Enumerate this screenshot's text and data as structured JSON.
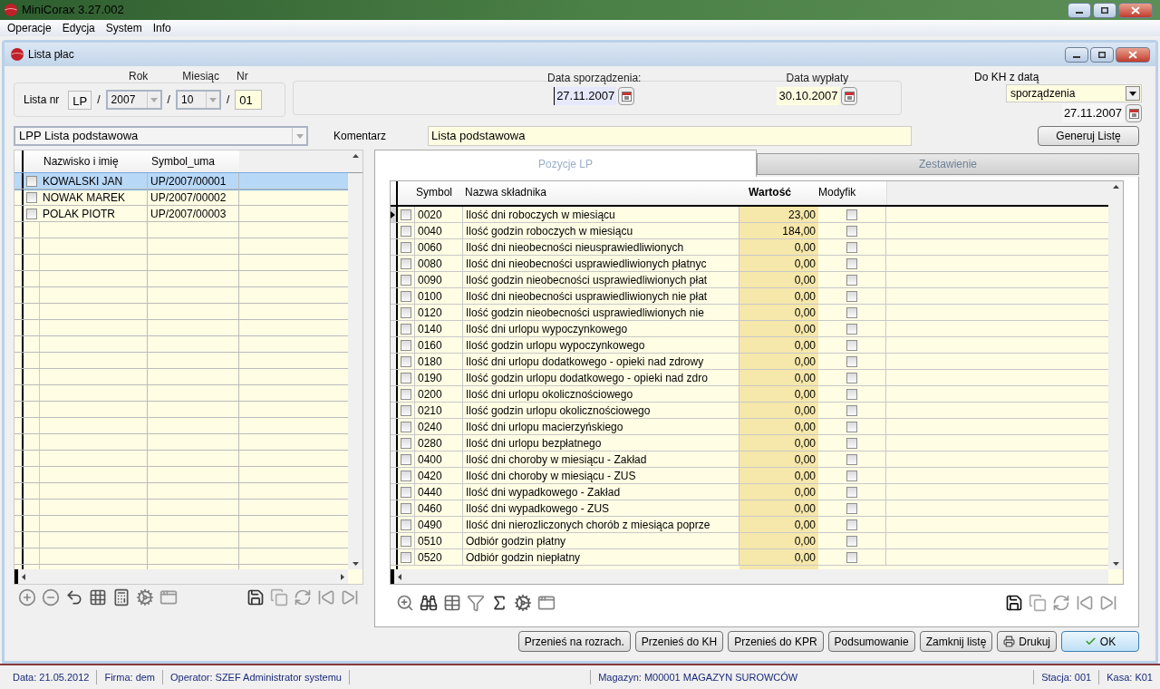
{
  "app_title": "MiniCorax 3.27.002",
  "menu": [
    "Operacje",
    "Edycja",
    "System",
    "Info"
  ],
  "window": {
    "title": "Lista płac"
  },
  "list_number": {
    "label": "Lista nr",
    "prefix": "LP",
    "year_label": "Rok",
    "year": "2007",
    "month_label": "Miesiąc",
    "month": "10",
    "nr_label": "Nr",
    "nr": "01",
    "separator": "/"
  },
  "dates": [
    {
      "label": "Data sporządzenia:",
      "value": "27.11.2007",
      "focused": true
    },
    {
      "label": "Data wypłaty",
      "value": "30.10.2007",
      "focused": false
    }
  ],
  "do_kh": {
    "label": "Do KH z datą",
    "mode": "sporządzenia",
    "date": "27.11.2007"
  },
  "list_type": "LPP Lista podstawowa",
  "comment": {
    "label": "Komentarz",
    "value": "Lista podstawowa"
  },
  "generate_button": "Generuj Listę",
  "employees": {
    "columns": [
      "Nazwisko i imię",
      "Symbol_uma"
    ],
    "rows": [
      {
        "name": "KOWALSKI JAN",
        "symbol": "UP/2007/00001",
        "checked": false,
        "selected": true
      },
      {
        "name": "NOWAK MAREK",
        "symbol": "UP/2007/00002",
        "checked": false,
        "selected": false
      },
      {
        "name": "POLAK PIOTR",
        "symbol": "UP/2007/00003",
        "checked": false,
        "selected": false
      }
    ]
  },
  "tabs": [
    {
      "label": "Pozycje LP",
      "selected": true
    },
    {
      "label": "Zestawienie",
      "selected": false
    }
  ],
  "components": {
    "columns": [
      "Symbol",
      "Nazwa składnika",
      "Wartość",
      "Modyfik"
    ],
    "rows": [
      {
        "symbol": "0020",
        "name": "Ilość dni roboczych w miesiącu",
        "value": "23,00",
        "checked": false,
        "modified": false,
        "selected": true
      },
      {
        "symbol": "0040",
        "name": "Ilość godzin roboczych w miesiącu",
        "value": "184,00",
        "checked": false,
        "modified": false,
        "selected": false
      },
      {
        "symbol": "0060",
        "name": "Ilość dni nieobecności nieusprawiedliwionych",
        "value": "0,00",
        "checked": false,
        "modified": false,
        "selected": false
      },
      {
        "symbol": "0080",
        "name": "Ilość dni nieobecności usprawiedliwionych płatnyc",
        "value": "0,00",
        "checked": false,
        "modified": false,
        "selected": false
      },
      {
        "symbol": "0090",
        "name": "Ilość godzin nieobecności usprawiedliwionych płat",
        "value": "0,00",
        "checked": false,
        "modified": false,
        "selected": false
      },
      {
        "symbol": "0100",
        "name": "Ilość dni nieobecności usprawiedliwionych nie płat",
        "value": "0,00",
        "checked": false,
        "modified": false,
        "selected": false
      },
      {
        "symbol": "0120",
        "name": "Ilość godzin nieobecności usprawiedliwionych nie",
        "value": "0,00",
        "checked": false,
        "modified": false,
        "selected": false
      },
      {
        "symbol": "0140",
        "name": "Ilość dni urlopu wypoczynkowego",
        "value": "0,00",
        "checked": false,
        "modified": false,
        "selected": false
      },
      {
        "symbol": "0160",
        "name": "Ilość godzin urlopu wypoczynkowego",
        "value": "0,00",
        "checked": false,
        "modified": false,
        "selected": false
      },
      {
        "symbol": "0180",
        "name": "Ilość dni urlopu dodatkowego - opieki nad zdrowy",
        "value": "0,00",
        "checked": false,
        "modified": false,
        "selected": false
      },
      {
        "symbol": "0190",
        "name": "Ilość godzin urlopu dodatkowego - opieki nad zdro",
        "value": "0,00",
        "checked": false,
        "modified": false,
        "selected": false
      },
      {
        "symbol": "0200",
        "name": "Ilość dni urlopu okolicznościowego",
        "value": "0,00",
        "checked": false,
        "modified": false,
        "selected": false
      },
      {
        "symbol": "0210",
        "name": "Ilość godzin urlopu okolicznościowego",
        "value": "0,00",
        "checked": false,
        "modified": false,
        "selected": false
      },
      {
        "symbol": "0240",
        "name": "Ilość dni urlopu macierzyńskiego",
        "value": "0,00",
        "checked": false,
        "modified": false,
        "selected": false
      },
      {
        "symbol": "0280",
        "name": "Ilość dni urlopu bezpłatnego",
        "value": "0,00",
        "checked": false,
        "modified": false,
        "selected": false
      },
      {
        "symbol": "0400",
        "name": "Ilość dni choroby w miesiącu - Zakład",
        "value": "0,00",
        "checked": false,
        "modified": false,
        "selected": false
      },
      {
        "symbol": "0420",
        "name": "Ilość dni choroby w miesiącu - ZUS",
        "value": "0,00",
        "checked": false,
        "modified": false,
        "selected": false
      },
      {
        "symbol": "0440",
        "name": "Ilość dni wypadkowego - Zakład",
        "value": "0,00",
        "checked": false,
        "modified": false,
        "selected": false
      },
      {
        "symbol": "0460",
        "name": "Ilość dni wypadkowego - ZUS",
        "value": "0,00",
        "checked": false,
        "modified": false,
        "selected": false
      },
      {
        "symbol": "0490",
        "name": "Ilość dni nierozliczonych chorób z miesiąca poprze",
        "value": "0,00",
        "checked": false,
        "modified": false,
        "selected": false
      },
      {
        "symbol": "0510",
        "name": "Odbiór godzin płatny",
        "value": "0,00",
        "checked": false,
        "modified": false,
        "selected": false
      },
      {
        "symbol": "0520",
        "name": "Odbiór godzin niepłatny",
        "value": "0,00",
        "checked": false,
        "modified": false,
        "selected": false
      }
    ]
  },
  "buttons": [
    {
      "label": "Przenieś na rozrach.",
      "kind": "plain"
    },
    {
      "label": "Przenieś do KH",
      "kind": "plain"
    },
    {
      "label": "Przenieś do KPR",
      "kind": "plain"
    },
    {
      "label": "Podsumowanie",
      "kind": "plain"
    },
    {
      "label": "Zamknij listę",
      "kind": "plain"
    },
    {
      "label": "Drukuj",
      "kind": "print"
    },
    {
      "label": "OK",
      "kind": "ok"
    }
  ],
  "status_bar": {
    "left": [
      "Data: 21.05.2012",
      "Firma: dem",
      "Operator: SZEF Administrator systemu"
    ],
    "center": "Magazyn: M00001 MAGAZYN SUROWCÓW",
    "right": [
      "Stacja: 001",
      "Kasa: K01"
    ]
  }
}
